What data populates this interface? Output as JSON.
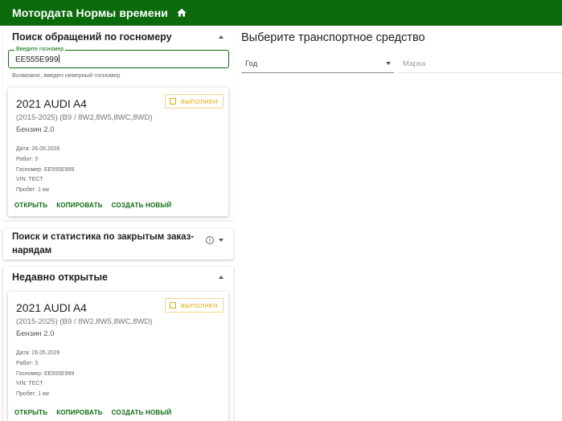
{
  "appbar": {
    "title": "Мотордата Нормы времени",
    "home_icon": "home-icon"
  },
  "search_panel": {
    "title": "Поиск обращений по госномеру",
    "field_label": "Введите госномер",
    "field_value": "EE555E999",
    "hint": "Возможно, введен неверный госномер"
  },
  "cards": [
    {
      "title": "2021 AUDI A4",
      "subtitle": "(2015-2025) (B9 / 8W2,8W5,8WC,8WD)",
      "fuel": "Бензин 2.0",
      "meta": [
        "Дата: 26.05.2026",
        "Работ: 3",
        "Госномер: EE555E999",
        "VIN: TECT",
        "Пробег: 1 км"
      ],
      "badge": "ВЫПОЛНЕН",
      "actions": [
        "ОТКРЫТЬ",
        "КОПИРОВАТЬ",
        "СОЗДАТЬ НОВЫЙ"
      ]
    },
    {
      "title": "2021 AUDI A4",
      "subtitle": "(2015-2025) (B9 / 8W2,8W5,8WC,8WD)",
      "fuel": "Бензин 2.0",
      "meta": [
        "Дата: 26.05.2026",
        "Работ: 3",
        "Госномер: EE555E999",
        "VIN: TECT",
        "Пробег: 1 км"
      ],
      "badge": "ВЫПОЛНЕН",
      "actions": [
        "ОТКРЫТЬ",
        "КОПИРОВАТЬ",
        "СОЗДАТЬ НОВЫЙ"
      ]
    }
  ],
  "stats_panel": {
    "title_line1": "Поиск и статистика по закрытым заказ-",
    "title_line2": "нарядам",
    "info_glyph": "i"
  },
  "recent_panel": {
    "title": "Недавно открытые"
  },
  "main": {
    "title": "Выберите транспортное средство",
    "year_placeholder": "Год",
    "brand_placeholder": "Марка"
  },
  "colors": {
    "primary": "#0b6a0b",
    "badge": "#e0a800"
  }
}
